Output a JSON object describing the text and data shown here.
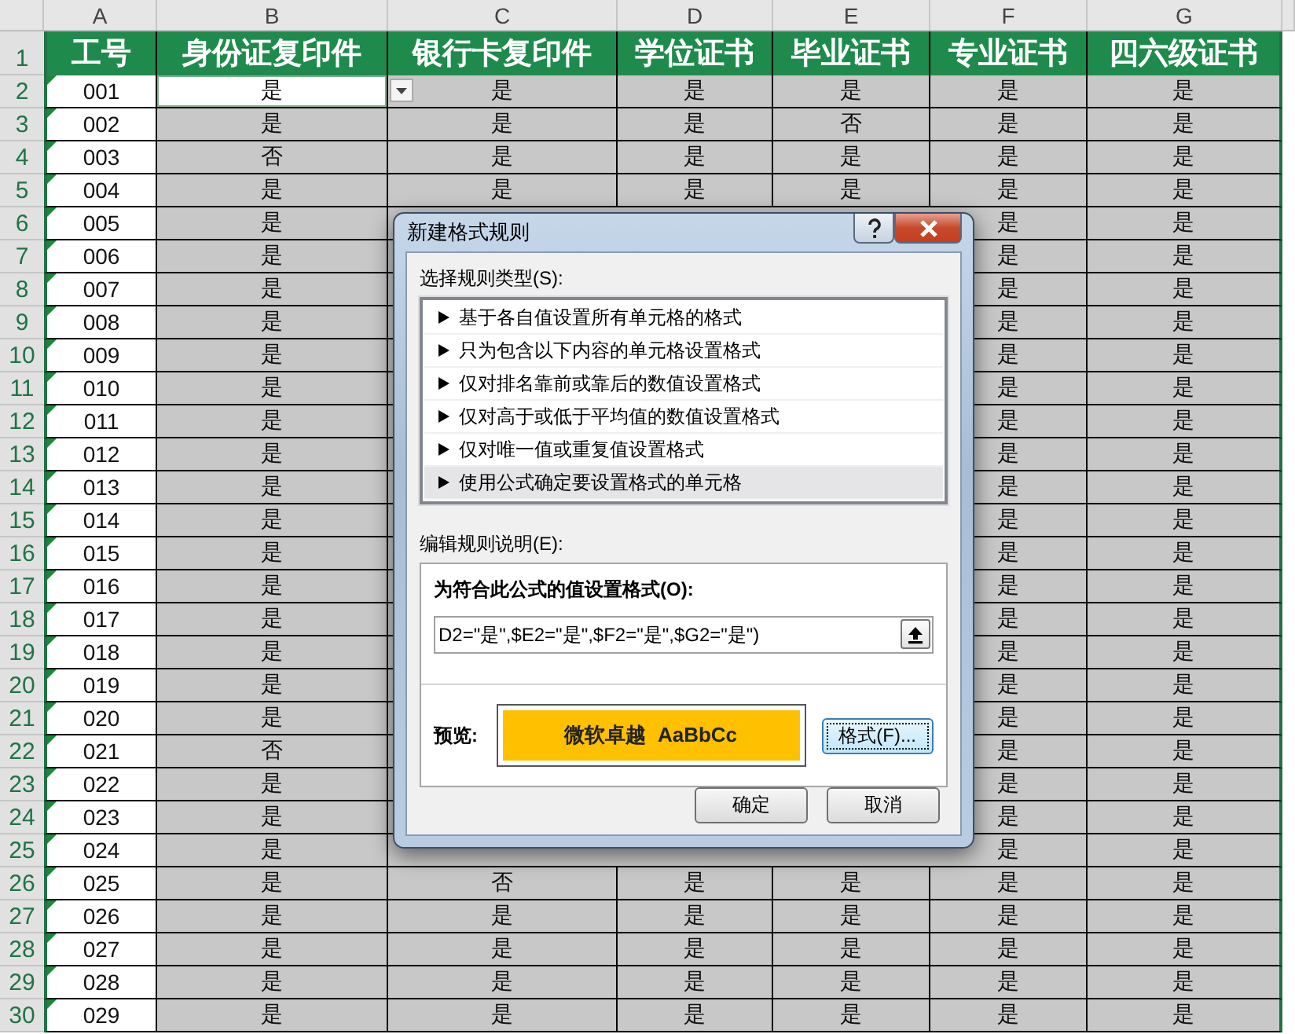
{
  "sheet": {
    "column_headers": [
      "A",
      "B",
      "C",
      "D",
      "E",
      "F",
      "G"
    ],
    "header_row": {
      "number": "1",
      "cells": [
        "工号",
        "身份证复印件",
        "银行卡复印件",
        "学位证书",
        "毕业证书",
        "专业证书",
        "四六级证书"
      ]
    },
    "rows": [
      {
        "number": "2",
        "cells": [
          {
            "text": "001",
            "selected": false
          },
          {
            "text": "是",
            "selected": true
          },
          {
            "text": "是",
            "selected": false
          },
          {
            "text": "是",
            "selected": false
          },
          {
            "text": "是",
            "selected": false
          },
          {
            "text": "是",
            "selected": false
          },
          {
            "text": "是",
            "selected": false
          }
        ]
      },
      {
        "number": "3",
        "cells": [
          {
            "text": "002",
            "selected": false
          },
          {
            "text": "是",
            "selected": false
          },
          {
            "text": "是",
            "selected": false
          },
          {
            "text": "是",
            "selected": false
          },
          {
            "text": "否",
            "selected": false
          },
          {
            "text": "是",
            "selected": false
          },
          {
            "text": "是",
            "selected": false
          }
        ]
      },
      {
        "number": "4",
        "cells": [
          {
            "text": "003",
            "selected": false
          },
          {
            "text": "否",
            "selected": false
          },
          {
            "text": "是",
            "selected": false
          },
          {
            "text": "是",
            "selected": false
          },
          {
            "text": "是",
            "selected": false
          },
          {
            "text": "是",
            "selected": false
          },
          {
            "text": "是",
            "selected": false
          }
        ]
      },
      {
        "number": "5",
        "cells": [
          {
            "text": "004",
            "selected": false
          },
          {
            "text": "是",
            "selected": false
          },
          {
            "text": "是",
            "selected": false
          },
          {
            "text": "是",
            "selected": false
          },
          {
            "text": "是",
            "selected": false
          },
          {
            "text": "是",
            "selected": false
          },
          {
            "text": "是",
            "selected": false
          }
        ]
      },
      {
        "number": "6",
        "cells": [
          {
            "text": "005",
            "selected": false
          },
          {
            "text": "是",
            "selected": false
          },
          null,
          null,
          null,
          {
            "text": "是",
            "selected": false
          },
          {
            "text": "是",
            "selected": false
          }
        ]
      },
      {
        "number": "7",
        "cells": [
          {
            "text": "006",
            "selected": false
          },
          {
            "text": "是",
            "selected": false
          },
          null,
          null,
          null,
          {
            "text": "是",
            "selected": false
          },
          {
            "text": "是",
            "selected": false
          }
        ]
      },
      {
        "number": "8",
        "cells": [
          {
            "text": "007",
            "selected": false
          },
          {
            "text": "是",
            "selected": false
          },
          null,
          null,
          null,
          {
            "text": "是",
            "selected": false
          },
          {
            "text": "是",
            "selected": false
          }
        ]
      },
      {
        "number": "9",
        "cells": [
          {
            "text": "008",
            "selected": false
          },
          {
            "text": "是",
            "selected": false
          },
          null,
          null,
          null,
          {
            "text": "是",
            "selected": false
          },
          {
            "text": "是",
            "selected": false
          }
        ]
      },
      {
        "number": "10",
        "cells": [
          {
            "text": "009",
            "selected": false
          },
          {
            "text": "是",
            "selected": false
          },
          null,
          null,
          null,
          {
            "text": "是",
            "selected": false
          },
          {
            "text": "是",
            "selected": false
          }
        ]
      },
      {
        "number": "11",
        "cells": [
          {
            "text": "010",
            "selected": false
          },
          {
            "text": "是",
            "selected": false
          },
          null,
          null,
          null,
          {
            "text": "是",
            "selected": false
          },
          {
            "text": "是",
            "selected": false
          }
        ]
      },
      {
        "number": "12",
        "cells": [
          {
            "text": "011",
            "selected": false
          },
          {
            "text": "是",
            "selected": false
          },
          null,
          null,
          null,
          {
            "text": "是",
            "selected": false
          },
          {
            "text": "是",
            "selected": false
          }
        ]
      },
      {
        "number": "13",
        "cells": [
          {
            "text": "012",
            "selected": false
          },
          {
            "text": "是",
            "selected": false
          },
          null,
          null,
          null,
          {
            "text": "是",
            "selected": false
          },
          {
            "text": "是",
            "selected": false
          }
        ]
      },
      {
        "number": "14",
        "cells": [
          {
            "text": "013",
            "selected": false
          },
          {
            "text": "是",
            "selected": false
          },
          null,
          null,
          null,
          {
            "text": "是",
            "selected": false
          },
          {
            "text": "是",
            "selected": false
          }
        ]
      },
      {
        "number": "15",
        "cells": [
          {
            "text": "014",
            "selected": false
          },
          {
            "text": "是",
            "selected": false
          },
          null,
          null,
          null,
          {
            "text": "是",
            "selected": false
          },
          {
            "text": "是",
            "selected": false
          }
        ]
      },
      {
        "number": "16",
        "cells": [
          {
            "text": "015",
            "selected": false
          },
          {
            "text": "是",
            "selected": false
          },
          null,
          null,
          null,
          {
            "text": "是",
            "selected": false
          },
          {
            "text": "是",
            "selected": false
          }
        ]
      },
      {
        "number": "17",
        "cells": [
          {
            "text": "016",
            "selected": false
          },
          {
            "text": "是",
            "selected": false
          },
          null,
          null,
          null,
          {
            "text": "是",
            "selected": false
          },
          {
            "text": "是",
            "selected": false
          }
        ]
      },
      {
        "number": "18",
        "cells": [
          {
            "text": "017",
            "selected": false
          },
          {
            "text": "是",
            "selected": false
          },
          null,
          null,
          null,
          {
            "text": "是",
            "selected": false
          },
          {
            "text": "是",
            "selected": false
          }
        ]
      },
      {
        "number": "19",
        "cells": [
          {
            "text": "018",
            "selected": false
          },
          {
            "text": "是",
            "selected": false
          },
          null,
          null,
          null,
          {
            "text": "是",
            "selected": false
          },
          {
            "text": "是",
            "selected": false
          }
        ]
      },
      {
        "number": "20",
        "cells": [
          {
            "text": "019",
            "selected": false
          },
          {
            "text": "是",
            "selected": false
          },
          null,
          null,
          null,
          {
            "text": "是",
            "selected": false
          },
          {
            "text": "是",
            "selected": false
          }
        ]
      },
      {
        "number": "21",
        "cells": [
          {
            "text": "020",
            "selected": false
          },
          {
            "text": "是",
            "selected": false
          },
          null,
          null,
          null,
          {
            "text": "是",
            "selected": false
          },
          {
            "text": "是",
            "selected": false
          }
        ]
      },
      {
        "number": "22",
        "cells": [
          {
            "text": "021",
            "selected": false
          },
          {
            "text": "否",
            "selected": false
          },
          null,
          null,
          null,
          {
            "text": "是",
            "selected": false
          },
          {
            "text": "是",
            "selected": false
          }
        ]
      },
      {
        "number": "23",
        "cells": [
          {
            "text": "022",
            "selected": false
          },
          {
            "text": "是",
            "selected": false
          },
          null,
          null,
          null,
          {
            "text": "是",
            "selected": false
          },
          {
            "text": "是",
            "selected": false
          }
        ]
      },
      {
        "number": "24",
        "cells": [
          {
            "text": "023",
            "selected": false
          },
          {
            "text": "是",
            "selected": false
          },
          null,
          null,
          null,
          {
            "text": "是",
            "selected": false
          },
          {
            "text": "是",
            "selected": false
          }
        ]
      },
      {
        "number": "25",
        "cells": [
          {
            "text": "024",
            "selected": false
          },
          {
            "text": "是",
            "selected": false
          },
          null,
          null,
          null,
          {
            "text": "是",
            "selected": false
          },
          {
            "text": "是",
            "selected": false
          }
        ]
      },
      {
        "number": "26",
        "cells": [
          {
            "text": "025",
            "selected": false
          },
          {
            "text": "是",
            "selected": false
          },
          {
            "text": "否",
            "selected": false
          },
          {
            "text": "是",
            "selected": false
          },
          {
            "text": "是",
            "selected": false
          },
          {
            "text": "是",
            "selected": false
          },
          {
            "text": "是",
            "selected": false
          }
        ]
      },
      {
        "number": "27",
        "cells": [
          {
            "text": "026",
            "selected": false
          },
          {
            "text": "是",
            "selected": false
          },
          {
            "text": "是",
            "selected": false
          },
          {
            "text": "是",
            "selected": false
          },
          {
            "text": "是",
            "selected": false
          },
          {
            "text": "是",
            "selected": false
          },
          {
            "text": "是",
            "selected": false
          }
        ]
      },
      {
        "number": "28",
        "cells": [
          {
            "text": "027",
            "selected": false
          },
          {
            "text": "是",
            "selected": false
          },
          {
            "text": "是",
            "selected": false
          },
          {
            "text": "是",
            "selected": false
          },
          {
            "text": "是",
            "selected": false
          },
          {
            "text": "是",
            "selected": false
          },
          {
            "text": "是",
            "selected": false
          }
        ]
      },
      {
        "number": "29",
        "cells": [
          {
            "text": "028",
            "selected": false
          },
          {
            "text": "是",
            "selected": false
          },
          {
            "text": "是",
            "selected": false
          },
          {
            "text": "是",
            "selected": false
          },
          {
            "text": "是",
            "selected": false
          },
          {
            "text": "是",
            "selected": false
          },
          {
            "text": "是",
            "selected": false
          }
        ]
      },
      {
        "number": "30",
        "cells": [
          {
            "text": "029",
            "selected": false
          },
          {
            "text": "是",
            "selected": false
          },
          {
            "text": "是",
            "selected": false
          },
          {
            "text": "是",
            "selected": false
          },
          {
            "text": "是",
            "selected": false
          },
          {
            "text": "是",
            "selected": false
          },
          {
            "text": "是",
            "selected": false
          }
        ]
      }
    ]
  },
  "dialog": {
    "title": "新建格式规则",
    "rule_type_label": "选择规则类型(S):",
    "rule_types": [
      {
        "label": "基于各自值设置所有单元格的格式",
        "selected": false
      },
      {
        "label": "只为包含以下内容的单元格设置格式",
        "selected": false
      },
      {
        "label": "仅对排名靠前或靠后的数值设置格式",
        "selected": false
      },
      {
        "label": "仅对高于或低于平均值的数值设置格式",
        "selected": false
      },
      {
        "label": "仅对唯一值或重复值设置格式",
        "selected": false
      },
      {
        "label": "使用公式确定要设置格式的单元格",
        "selected": true
      }
    ],
    "description_label": "编辑规则说明(E):",
    "formula_label": "为符合此公式的值设置格式(O):",
    "formula": "D2=\"是\",$E2=\"是\",$F2=\"是\",$G2=\"是\")",
    "preview_label": "预览:",
    "preview_text": "微软卓越  AaBbCc",
    "format_button": "格式(F)...",
    "buttons": [
      "确定",
      "取消"
    ]
  }
}
